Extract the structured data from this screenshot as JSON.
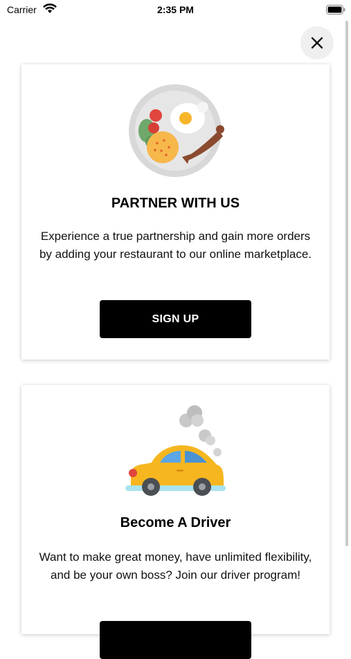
{
  "status_bar": {
    "carrier": "Carrier",
    "time": "2:35 PM",
    "icons": [
      "wifi-icon",
      "battery-icon"
    ]
  },
  "close_button": {
    "icon": "close-icon"
  },
  "cards": [
    {
      "illustration": "plate-breakfast-icon",
      "title": "PARTNER WITH US",
      "text": "Experience a true partnership and gain more orders by adding your restaurant to our online marketplace.",
      "button_label": "SIGN UP"
    },
    {
      "illustration": "car-driver-icon",
      "title": "Become A Driver",
      "text": "Want to make great money, have unlimited flexibility, and be your own boss? Join our driver program!",
      "button_label": ""
    }
  ],
  "colors": {
    "button": "#000000",
    "close_bg": "#efefef",
    "plate": "#d8d8d8",
    "car_body": "#f6b620"
  }
}
